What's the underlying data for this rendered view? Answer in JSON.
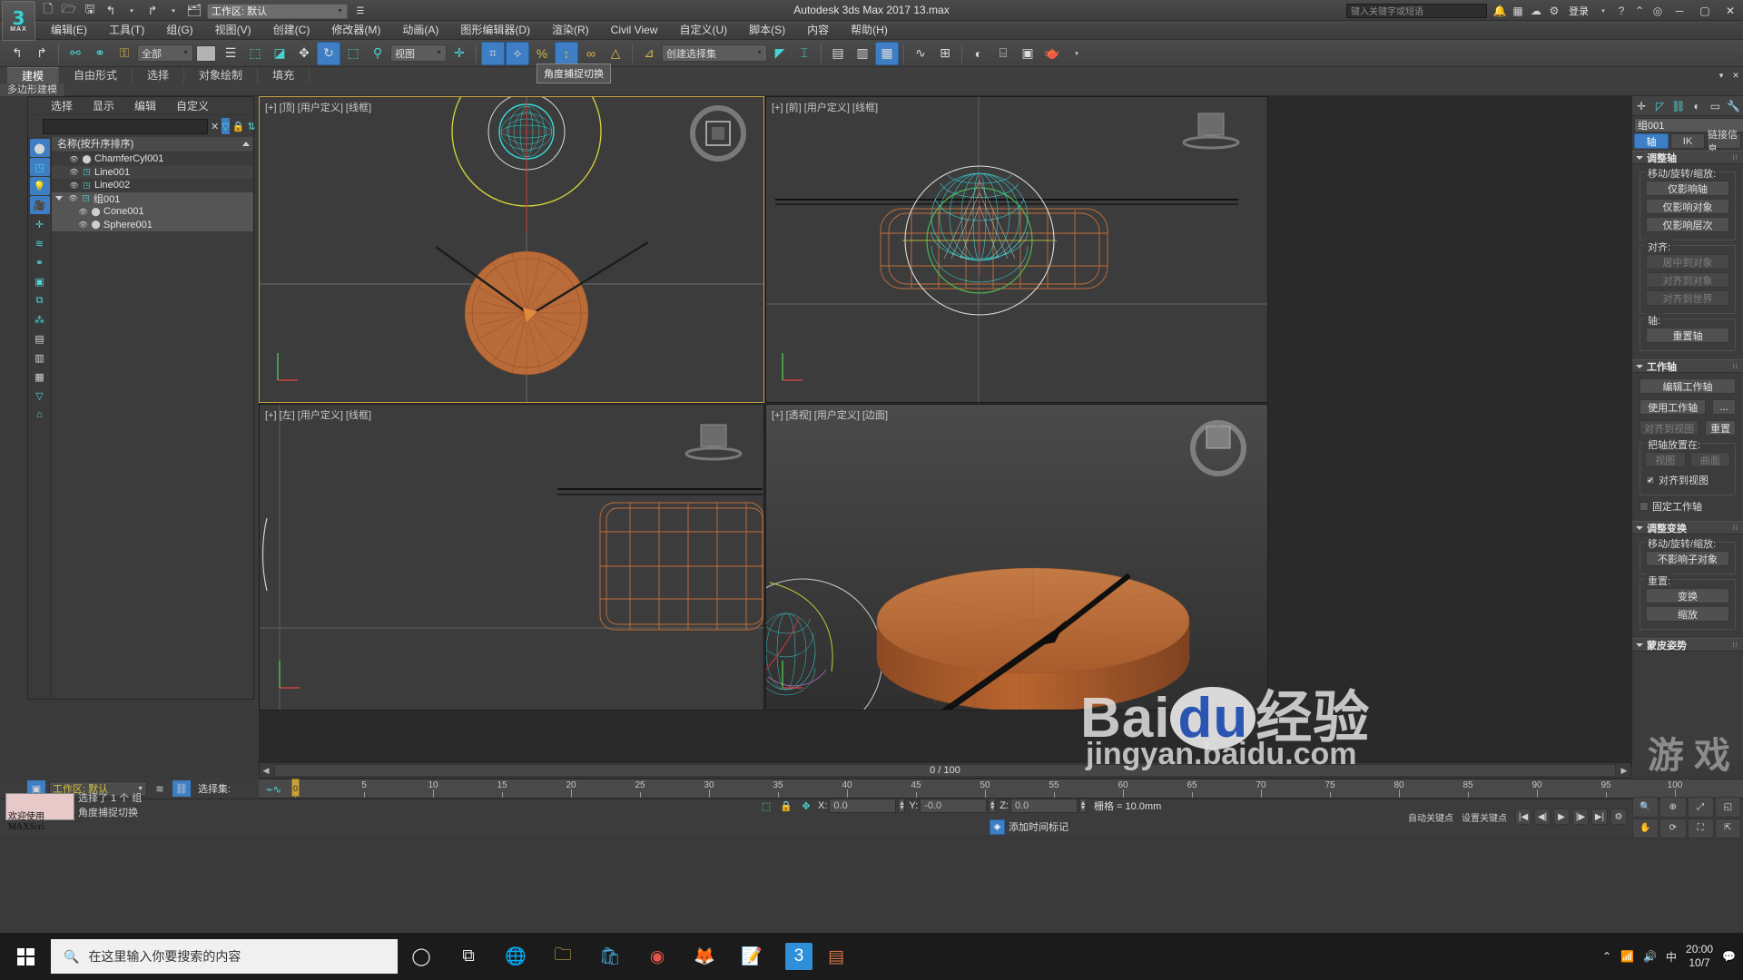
{
  "titlebar": {
    "app_title": "Autodesk 3ds Max 2017    13.max",
    "logo_big": "3",
    "logo_small": "MAX",
    "workspace_label": "工作区: 默认",
    "search_placeholder": "键入关键字或短语",
    "signin": "登录",
    "qat_icons": [
      "new-file-icon",
      "open-file-icon",
      "save-icon",
      "undo-icon",
      "undo-dropdown-icon",
      "redo-icon",
      "redo-dropdown-icon",
      "project-folder-icon"
    ],
    "window_buttons": [
      "minimize",
      "maximize",
      "close"
    ]
  },
  "menubar": {
    "items": [
      {
        "label": "编辑(E)",
        "name": "menu-edit"
      },
      {
        "label": "工具(T)",
        "name": "menu-tools"
      },
      {
        "label": "组(G)",
        "name": "menu-group"
      },
      {
        "label": "视图(V)",
        "name": "menu-views"
      },
      {
        "label": "创建(C)",
        "name": "menu-create"
      },
      {
        "label": "修改器(M)",
        "name": "menu-modifiers"
      },
      {
        "label": "动画(A)",
        "name": "menu-animation"
      },
      {
        "label": "图形编辑器(D)",
        "name": "menu-graph-editors"
      },
      {
        "label": "渲染(R)",
        "name": "menu-rendering"
      },
      {
        "label": "Civil View",
        "name": "menu-civil-view"
      },
      {
        "label": "自定义(U)",
        "name": "menu-customize"
      },
      {
        "label": "脚本(S)",
        "name": "menu-scripting"
      },
      {
        "label": "内容",
        "name": "menu-content"
      },
      {
        "label": "帮助(H)",
        "name": "menu-help"
      }
    ]
  },
  "toolbar": {
    "select_filter": "全部",
    "ref_coord": "视图",
    "named_selection": "创建选择集",
    "tooltip": "角度捕捉切换"
  },
  "ribbon": {
    "tabs": [
      {
        "label": "建模",
        "active": true
      },
      {
        "label": "自由形式",
        "active": false
      },
      {
        "label": "选择",
        "active": false
      },
      {
        "label": "对象绘制",
        "active": false
      },
      {
        "label": "填充",
        "active": false
      }
    ],
    "subtab": "多边形建模"
  },
  "explorer": {
    "menu": [
      "选择",
      "显示",
      "编辑",
      "自定义"
    ],
    "search_value": "",
    "column_header": "名称(按升序排序)",
    "items": [
      {
        "label": "ChamferCyl001",
        "icon": "sphere-icon",
        "indent": 1,
        "selected": false
      },
      {
        "label": "Line001",
        "icon": "shape-icon",
        "indent": 1,
        "selected": false
      },
      {
        "label": "Line002",
        "icon": "shape-icon",
        "indent": 1,
        "selected": false
      },
      {
        "label": "组001",
        "icon": "group-icon",
        "indent": 0,
        "selected": true,
        "expanded": true
      },
      {
        "label": "Cone001",
        "icon": "sphere-icon",
        "indent": 2,
        "selected": true
      },
      {
        "label": "Sphere001",
        "icon": "sphere-icon",
        "indent": 2,
        "selected": true
      }
    ]
  },
  "viewports": [
    {
      "name": "viewport-top",
      "label": "[+] [顶] [用户定义] [线框]",
      "active": true
    },
    {
      "name": "viewport-front",
      "label": "[+] [前] [用户定义] [线框]",
      "active": false
    },
    {
      "name": "viewport-left",
      "label": "[+] [左] [用户定义] [线框]",
      "active": false
    },
    {
      "name": "viewport-perspective",
      "label": "[+] [透视] [用户定义] [边面]",
      "active": false
    }
  ],
  "command_panel": {
    "object_name": "组001",
    "object_color": "#2255cc",
    "mode_tabs": [
      {
        "label": "轴",
        "active": true
      },
      {
        "label": "IK",
        "active": false
      },
      {
        "label": "链接信息",
        "active": false
      }
    ],
    "rollouts": [
      {
        "title": "调整轴",
        "groups": [
          {
            "label": "移动/旋转/缩放:",
            "buttons": [
              {
                "label": "仅影响轴",
                "disabled": false
              },
              {
                "label": "仅影响对象",
                "disabled": false
              },
              {
                "label": "仅影响层次",
                "disabled": false
              }
            ]
          },
          {
            "label": "对齐:",
            "buttons": [
              {
                "label": "居中到对象",
                "disabled": true
              },
              {
                "label": "对齐到对象",
                "disabled": true
              },
              {
                "label": "对齐到世界",
                "disabled": true
              }
            ]
          },
          {
            "label": "轴:",
            "buttons": [
              {
                "label": "重置轴",
                "disabled": false
              }
            ]
          }
        ]
      },
      {
        "title": "工作轴",
        "buttons_top": [
          {
            "label": "编辑工作轴",
            "disabled": false
          }
        ],
        "row_use": [
          {
            "label": "使用工作轴",
            "disabled": false
          },
          {
            "label": "...",
            "disabled": false
          }
        ],
        "row_align": [
          {
            "label": "对齐到视图",
            "disabled": true
          },
          {
            "label": "重置",
            "disabled": false
          }
        ],
        "place_group_label": "把轴放置在:",
        "place_buttons": [
          {
            "label": "视图",
            "disabled": true
          },
          {
            "label": "曲面",
            "disabled": true
          }
        ],
        "place_checkbox": {
          "label": "对齐到视图",
          "checked": true
        },
        "fixed_checkbox": {
          "label": "固定工作轴",
          "checked": false
        }
      },
      {
        "title": "调整变换",
        "groups": [
          {
            "label": "移动/旋转/缩放:",
            "buttons": [
              {
                "label": "不影响子对象",
                "disabled": false
              }
            ]
          },
          {
            "label": "重置:",
            "buttons": [
              {
                "label": "变换",
                "disabled": false
              },
              {
                "label": "缩放",
                "disabled": false
              }
            ]
          }
        ]
      },
      {
        "title": "蒙皮姿势"
      }
    ]
  },
  "timeline": {
    "current_frame_label": "0 / 100",
    "slider_frame": "0",
    "ticks": [
      0,
      5,
      10,
      15,
      20,
      25,
      30,
      35,
      40,
      45,
      50,
      55,
      60,
      65,
      70,
      75,
      80,
      85,
      90,
      95,
      100
    ]
  },
  "status": {
    "workspace_label": "工作区: 默认",
    "selection_set_label": "选择集:",
    "prompt_button": "欢迎使用 MAXScri",
    "line1": "选择了 1 个 组",
    "line2": "角度捕捉切换",
    "coords": {
      "x_label": "X:",
      "x_value": "0.0",
      "y_label": "Y:",
      "y_value": "-0.0",
      "z_label": "Z:",
      "z_value": "0.0",
      "grid_text": "栅格 = 10.0mm"
    },
    "add_time_tag": "添加时间标记",
    "auto_key": "自动关键点",
    "set_key": "设置关键点"
  },
  "taskbar": {
    "search_placeholder": "在这里输入你要搜索的内容",
    "apps": [
      "cortana-icon",
      "task-view-icon",
      "edge-icon",
      "file-explorer-icon",
      "store-icon",
      "chrome-icon",
      "firefox-icon",
      "notepad-icon",
      "max-icon",
      "ppt-icon"
    ],
    "clock_time": "20:00",
    "clock_date": "10/7"
  },
  "watermark": {
    "line1a": "Bai",
    "line1b": "du",
    "line1c": "经验",
    "line2": "jingyan.baidu.com",
    "line3": "游 戏"
  }
}
